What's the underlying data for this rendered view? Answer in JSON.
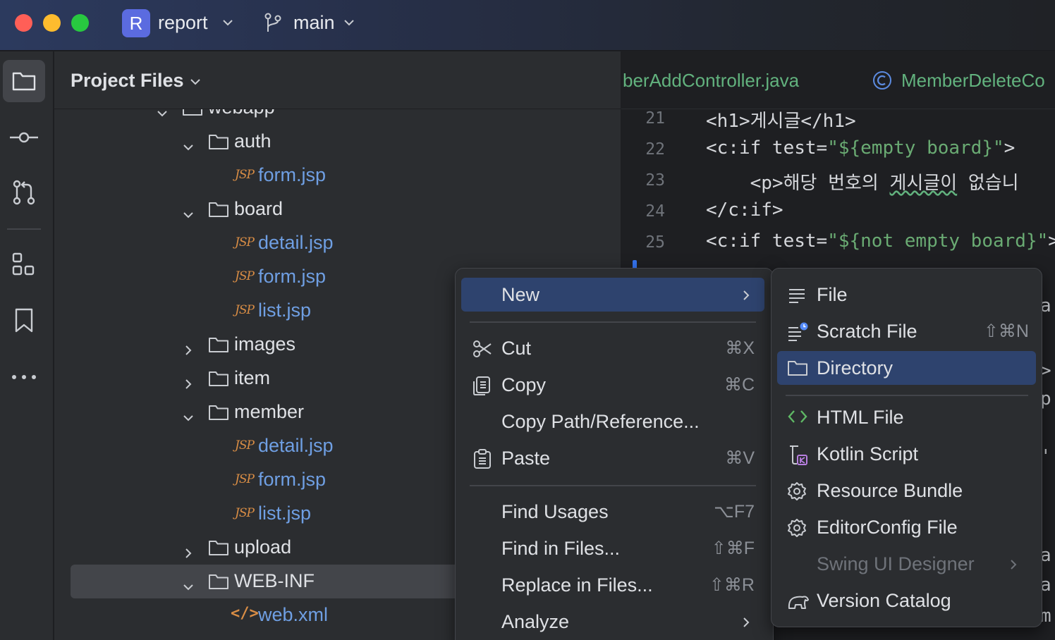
{
  "window": {
    "project_initial": "R",
    "project_name": "report",
    "branch_name": "main"
  },
  "toolstrip": {
    "items": [
      "folder-icon",
      "commit-icon",
      "pull-requests-icon",
      "structure-icon",
      "bookmark-icon",
      "more-icon"
    ],
    "active": "folder-icon"
  },
  "project_panel": {
    "title": "Project Files",
    "rows": [
      {
        "label": "webapp",
        "type": "folder",
        "expanded": true
      },
      {
        "label": "auth",
        "type": "folder",
        "expanded": true
      },
      {
        "label": "form.jsp",
        "type": "jsp",
        "tag": "JSP"
      },
      {
        "label": "board",
        "type": "folder",
        "expanded": true
      },
      {
        "label": "detail.jsp",
        "type": "jsp",
        "tag": "JSP"
      },
      {
        "label": "form.jsp",
        "type": "jsp",
        "tag": "JSP"
      },
      {
        "label": "list.jsp",
        "type": "jsp",
        "tag": "JSP"
      },
      {
        "label": "images",
        "type": "folder",
        "expanded": false
      },
      {
        "label": "item",
        "type": "folder",
        "expanded": false
      },
      {
        "label": "member",
        "type": "folder",
        "expanded": true
      },
      {
        "label": "detail.jsp",
        "type": "jsp",
        "tag": "JSP"
      },
      {
        "label": "form.jsp",
        "type": "jsp",
        "tag": "JSP"
      },
      {
        "label": "list.jsp",
        "type": "jsp",
        "tag": "JSP"
      },
      {
        "label": "upload",
        "type": "folder",
        "expanded": false
      },
      {
        "label": "WEB-INF",
        "type": "folder",
        "expanded": true,
        "selected": true
      },
      {
        "label": "web.xml",
        "type": "xml",
        "tag": "</>"
      }
    ]
  },
  "editor": {
    "tabs": [
      {
        "label": "berAddController.java"
      },
      {
        "label": "MemberDeleteCo"
      }
    ],
    "lines": [
      {
        "num": "21",
        "parts": [
          {
            "t": "<h1>게시글</h1>",
            "c": "plain"
          }
        ]
      },
      {
        "num": "22",
        "parts": [
          {
            "t": "<c:if test=",
            "c": "plain"
          },
          {
            "t": "\"${empty board}\"",
            "c": "str"
          },
          {
            "t": ">",
            "c": "plain"
          }
        ]
      },
      {
        "num": "23",
        "parts": [
          {
            "t": "    <p>해당 번호의 ",
            "c": "plain"
          },
          {
            "t": "게시글이",
            "c": "wavy"
          },
          {
            "t": " 없습니",
            "c": "plain"
          }
        ]
      },
      {
        "num": "24",
        "parts": [
          {
            "t": "</c:if>",
            "c": "plain"
          }
        ]
      },
      {
        "num": "25",
        "parts": [
          {
            "t": "<c:if test=",
            "c": "plain"
          },
          {
            "t": "\"${not empty board}\"",
            "c": "str"
          },
          {
            "t": ">",
            "c": "plain"
          }
        ]
      }
    ],
    "edge_glyphs": [
      "a",
      ">",
      "p",
      "'",
      "a",
      "a",
      "m"
    ]
  },
  "context_menu": {
    "items": [
      {
        "label": "New",
        "icon": "",
        "shortcut": "",
        "submenu": true,
        "highlighted": true
      },
      {
        "sep": true
      },
      {
        "label": "Cut",
        "icon": "scissors-icon",
        "shortcut": "⌘X"
      },
      {
        "label": "Copy",
        "icon": "copy-icon",
        "shortcut": "⌘C"
      },
      {
        "label": "Copy Path/Reference...",
        "icon": "",
        "shortcut": ""
      },
      {
        "label": "Paste",
        "icon": "paste-icon",
        "shortcut": "⌘V"
      },
      {
        "sep": true
      },
      {
        "label": "Find Usages",
        "icon": "",
        "shortcut": "⌥F7"
      },
      {
        "label": "Find in Files...",
        "icon": "",
        "shortcut": "⇧⌘F"
      },
      {
        "label": "Replace in Files...",
        "icon": "",
        "shortcut": "⇧⌘R"
      },
      {
        "label": "Analyze",
        "icon": "",
        "shortcut": "",
        "submenu": true
      }
    ]
  },
  "new_submenu": {
    "items": [
      {
        "label": "File",
        "icon": "file-lines-icon",
        "shortcut": ""
      },
      {
        "label": "Scratch File",
        "icon": "scratch-file-icon",
        "shortcut": "⇧⌘N"
      },
      {
        "label": "Directory",
        "icon": "folder-icon",
        "shortcut": "",
        "highlighted": true
      },
      {
        "sep": true
      },
      {
        "label": "HTML File",
        "icon": "html-icon",
        "shortcut": ""
      },
      {
        "label": "Kotlin Script",
        "icon": "kotlin-script-icon",
        "shortcut": ""
      },
      {
        "label": "Resource Bundle",
        "icon": "gear-icon",
        "shortcut": ""
      },
      {
        "label": "EditorConfig File",
        "icon": "gear-icon",
        "shortcut": ""
      },
      {
        "label": "Swing UI Designer",
        "icon": "",
        "shortcut": "",
        "submenu": true,
        "disabled": true
      },
      {
        "label": "Version Catalog",
        "icon": "elephant-icon",
        "shortcut": ""
      }
    ]
  },
  "colors": {
    "accent": "#3574f0",
    "selection": "#2e436e",
    "jsp_label": "#6f9fe3",
    "file_tag": "#d98d45",
    "vcs_added": "#62b27e"
  }
}
